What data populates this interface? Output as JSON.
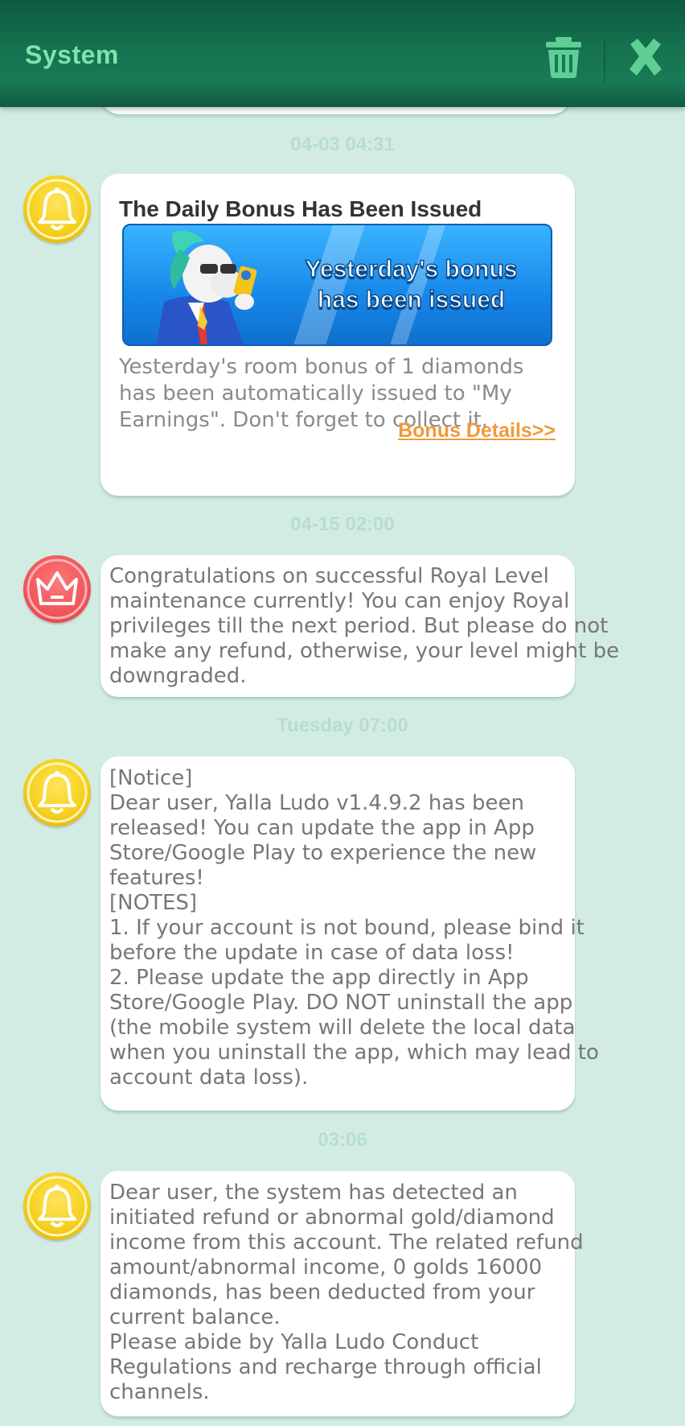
{
  "header": {
    "title": "System",
    "trash_icon": "trash-icon",
    "close_icon": "close-icon",
    "title_color": "#7fe2b0"
  },
  "messages": [
    {
      "timestamp": "04-03 04:31",
      "avatar": "bell-icon",
      "title": "The Daily Bonus Has Been Issued",
      "banner_text": [
        "Yesterday's bonus",
        "has been issued"
      ],
      "body": [
        "Yesterday's room bonus of 1 diamonds",
        "has been automatically issued to \"My",
        "Earnings\". Don't forget to collect it."
      ],
      "link": "Bonus Details>>"
    },
    {
      "timestamp": "04-15 02:00",
      "avatar": "crown-icon",
      "body": [
        "Congratulations on successful Royal Level",
        "maintenance currently! You can enjoy Royal",
        "privileges till the next period. But please do not",
        "make any refund, otherwise, your level might be",
        "downgraded."
      ]
    },
    {
      "timestamp": "Tuesday 07:00",
      "avatar": "bell-icon",
      "body": [
        "[Notice]",
        "Dear user, Yalla Ludo v1.4.9.2 has been",
        "released! You can update the app in App",
        "Store/Google Play to experience the new",
        "features!",
        "[NOTES]",
        "1. If your account is not bound, please bind it",
        "before the update in case of data loss!",
        "2. Please update the app directly in App",
        "Store/Google Play. DO NOT uninstall the app",
        "(the mobile system will delete the local data",
        "when you uninstall the app, which may lead to",
        "account data loss)."
      ]
    },
    {
      "timestamp": "03:06",
      "avatar": "bell-icon",
      "body": [
        "Dear user, the system has detected an",
        "initiated refund or abnormal gold/diamond",
        "income from this account. The related refund",
        "amount/abnormal income, 0 golds 16000",
        "diamonds, has been deducted from your",
        "current balance.",
        "Please abide by Yalla Ludo Conduct",
        "Regulations and recharge through official",
        "channels."
      ]
    }
  ]
}
